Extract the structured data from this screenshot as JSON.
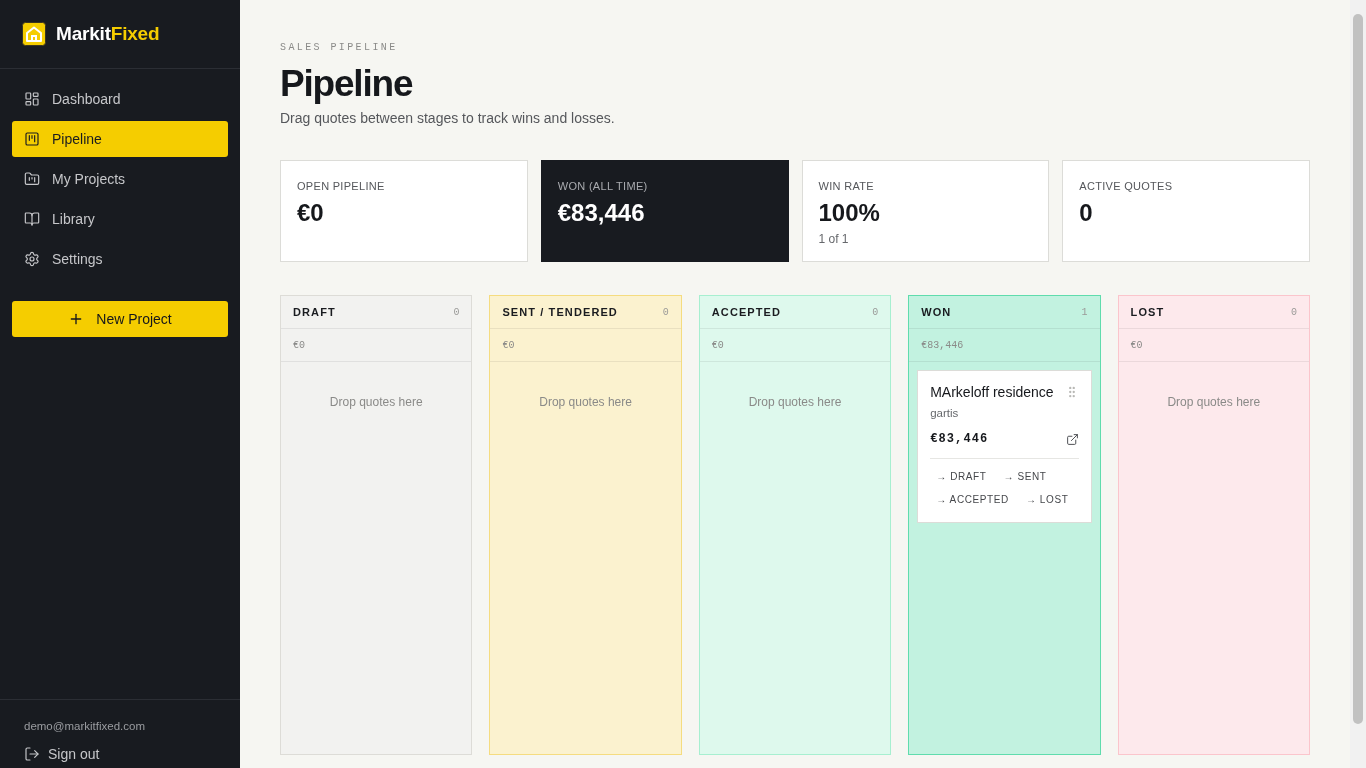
{
  "sidebar": {
    "brand": {
      "primary": "Markit",
      "accent": "Fixed"
    },
    "nav_items": [
      {
        "label": "Dashboard",
        "selected": false
      },
      {
        "label": "Pipeline",
        "selected": true
      },
      {
        "label": "My Projects",
        "selected": false
      },
      {
        "label": "Library",
        "selected": false
      },
      {
        "label": "Settings",
        "selected": false
      }
    ],
    "new_project_button": "New Project",
    "user_email": "demo@markitfixed.com",
    "sign_out": "Sign out"
  },
  "header": {
    "eyebrow": "SALES PIPELINE",
    "title": "Pipeline",
    "subtitle": "Drag quotes between stages to track wins and losses."
  },
  "stats": [
    {
      "label": "OPEN PIPELINE",
      "value": "€0",
      "highlighted": false
    },
    {
      "label": "WON (ALL TIME)",
      "value": "€83,446",
      "highlighted": true
    },
    {
      "label": "WIN RATE",
      "value": "100%",
      "note": "1 of 1",
      "highlighted": false
    },
    {
      "label": "ACTIVE QUOTES",
      "value": "0",
      "highlighted": false
    }
  ],
  "columns": [
    {
      "title": "DRAFT",
      "count": "0",
      "total": "€0",
      "color": "#dddcd7",
      "empty_text": "Drop quotes here"
    },
    {
      "title": "SENT / TENDERED",
      "count": "0",
      "total": "€0",
      "color": "#f5dc80",
      "empty_text": "Drop quotes here"
    },
    {
      "title": "ACCEPTED",
      "count": "0",
      "total": "€0",
      "color": "#a7efd0",
      "empty_text": "Drop quotes here"
    },
    {
      "title": "WON",
      "count": "1",
      "total": "€83,446",
      "color": "#5fdcad",
      "cards": [
        {
          "title": "MArkeloff residence",
          "client": "gartis",
          "amount": "€83,446",
          "actions": [
            "→ DRAFT",
            "→ SENT",
            "→ ACCEPTED",
            "→ LOST"
          ]
        }
      ]
    },
    {
      "title": "LOST",
      "count": "0",
      "total": "€0",
      "color": "#fbc5cc",
      "empty_text": "Drop quotes here"
    }
  ]
}
